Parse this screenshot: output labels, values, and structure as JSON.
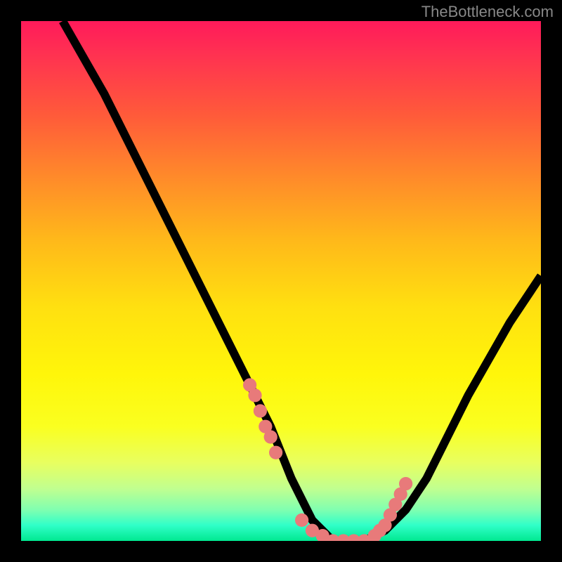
{
  "watermark": "TheBottleneck.com",
  "chart_data": {
    "type": "line",
    "title": "",
    "xlabel": "",
    "ylabel": "",
    "xlim": [
      0,
      100
    ],
    "ylim": [
      0,
      100
    ],
    "series": [
      {
        "name": "bottleneck-curve",
        "x": [
          8,
          12,
          16,
          20,
          24,
          28,
          32,
          36,
          40,
          44,
          48,
          50,
          52,
          54,
          56,
          58,
          60,
          62,
          64,
          66,
          70,
          74,
          78,
          82,
          86,
          90,
          94,
          98,
          100
        ],
        "y": [
          100,
          93,
          86,
          78,
          70,
          62,
          54,
          46,
          38,
          30,
          22,
          17,
          12,
          8,
          4,
          2,
          0,
          0,
          0,
          0,
          2,
          6,
          12,
          20,
          28,
          35,
          42,
          48,
          51
        ]
      }
    ],
    "highlight_points": {
      "name": "highlight-dots",
      "x": [
        44,
        45,
        46,
        47,
        48,
        49,
        54,
        56,
        58,
        60,
        62,
        64,
        66,
        68,
        69,
        70,
        71,
        72,
        73,
        74
      ],
      "y": [
        30,
        28,
        25,
        22,
        20,
        17,
        4,
        2,
        1,
        0,
        0,
        0,
        0,
        1,
        2,
        3,
        5,
        7,
        9,
        11
      ]
    }
  }
}
